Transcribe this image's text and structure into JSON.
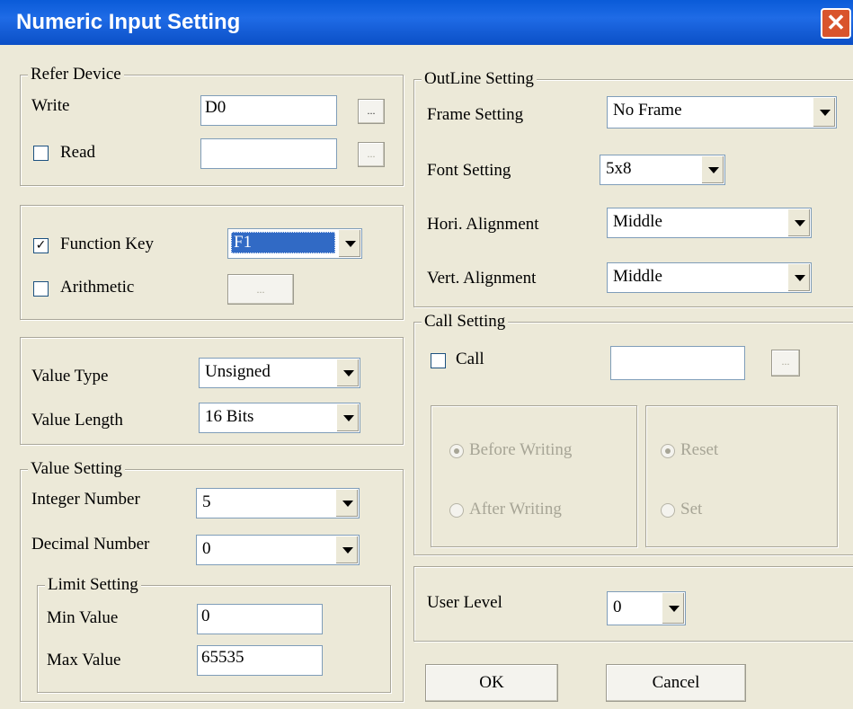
{
  "window": {
    "title": "Numeric Input Setting",
    "close_symbol": "✕"
  },
  "refer_device": {
    "legend": "Refer Device",
    "write_label": "Write",
    "write_value": "D0",
    "write_browse": "...",
    "read_label": "Read",
    "read_checked": false,
    "read_value": "",
    "read_browse": "..."
  },
  "function_key": {
    "label": "Function Key",
    "checked": true,
    "check_mark": "✓",
    "value": "F1",
    "arithmetic_label": "Arithmetic",
    "arithmetic_checked": false,
    "arithmetic_button": "..."
  },
  "value_type": {
    "type_label": "Value Type",
    "type_value": "Unsigned",
    "length_label": "Value Length",
    "length_value": "16 Bits"
  },
  "value_setting": {
    "legend": "Value Setting",
    "integer_label": "Integer Number",
    "integer_value": "5",
    "decimal_label": "Decimal Number",
    "decimal_value": "0"
  },
  "limit_setting": {
    "legend": "Limit Setting",
    "min_label": "Min Value",
    "min_value": "0",
    "max_label": "Max Value",
    "max_value": "65535"
  },
  "outline_setting": {
    "legend": "OutLine Setting",
    "frame_label": "Frame Setting",
    "frame_value": "No Frame",
    "font_label": "Font Setting",
    "font_value": "5x8",
    "hori_label": "Hori. Alignment",
    "hori_value": "Middle",
    "vert_label": "Vert. Alignment",
    "vert_value": "Middle"
  },
  "call_setting": {
    "legend": "Call Setting",
    "call_label": "Call",
    "call_checked": false,
    "call_value": "",
    "call_browse": "...",
    "before_writing": "Before Writing",
    "after_writing": "After Writing",
    "reset": "Reset",
    "set": "Set"
  },
  "user_level": {
    "label": "User Level",
    "value": "0"
  },
  "buttons": {
    "ok": "OK",
    "cancel": "Cancel"
  },
  "colors": {
    "title_bar": "#0a5bd8",
    "close": "#d9542c",
    "dialog_bg": "#ece9d8",
    "selection": "#316ac5"
  }
}
